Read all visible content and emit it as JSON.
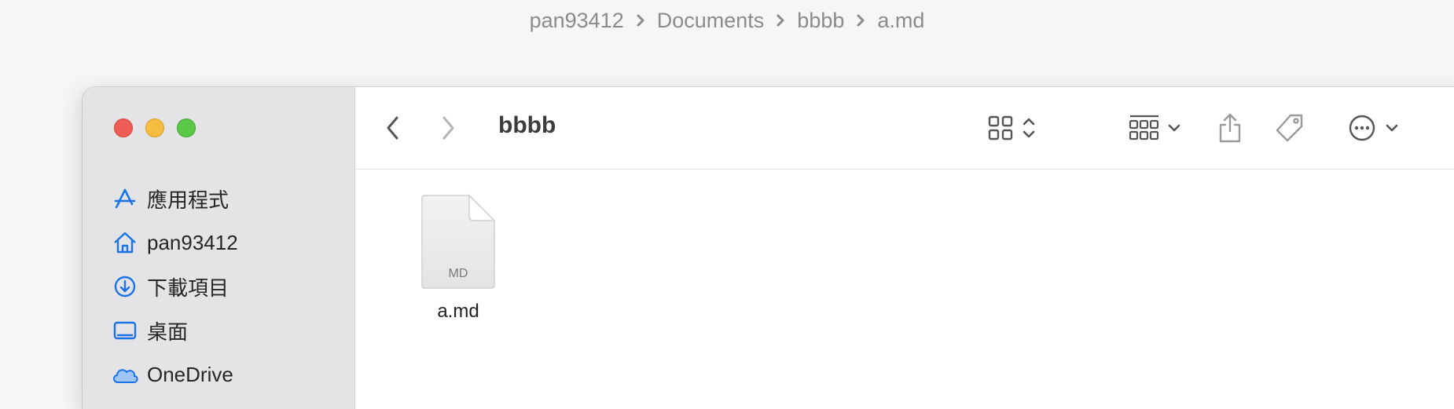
{
  "breadcrumb": [
    "pan93412",
    "Documents",
    "bbbb",
    "a.md"
  ],
  "sidebar": {
    "items": [
      {
        "label": "應用程式",
        "icon": "app-store-icon"
      },
      {
        "label": "pan93412",
        "icon": "home-icon"
      },
      {
        "label": "下載項目",
        "icon": "download-icon"
      },
      {
        "label": "桌面",
        "icon": "desktop-icon"
      },
      {
        "label": "OneDrive",
        "icon": "cloud-icon"
      }
    ]
  },
  "toolbar": {
    "folder_title": "bbbb"
  },
  "files": [
    {
      "name": "a.md",
      "type_label": "MD"
    }
  ],
  "colors": {
    "accent": "#1a73e8",
    "close": "#ee5e57",
    "minimize": "#f4bd3f",
    "maximize": "#5ac746"
  }
}
